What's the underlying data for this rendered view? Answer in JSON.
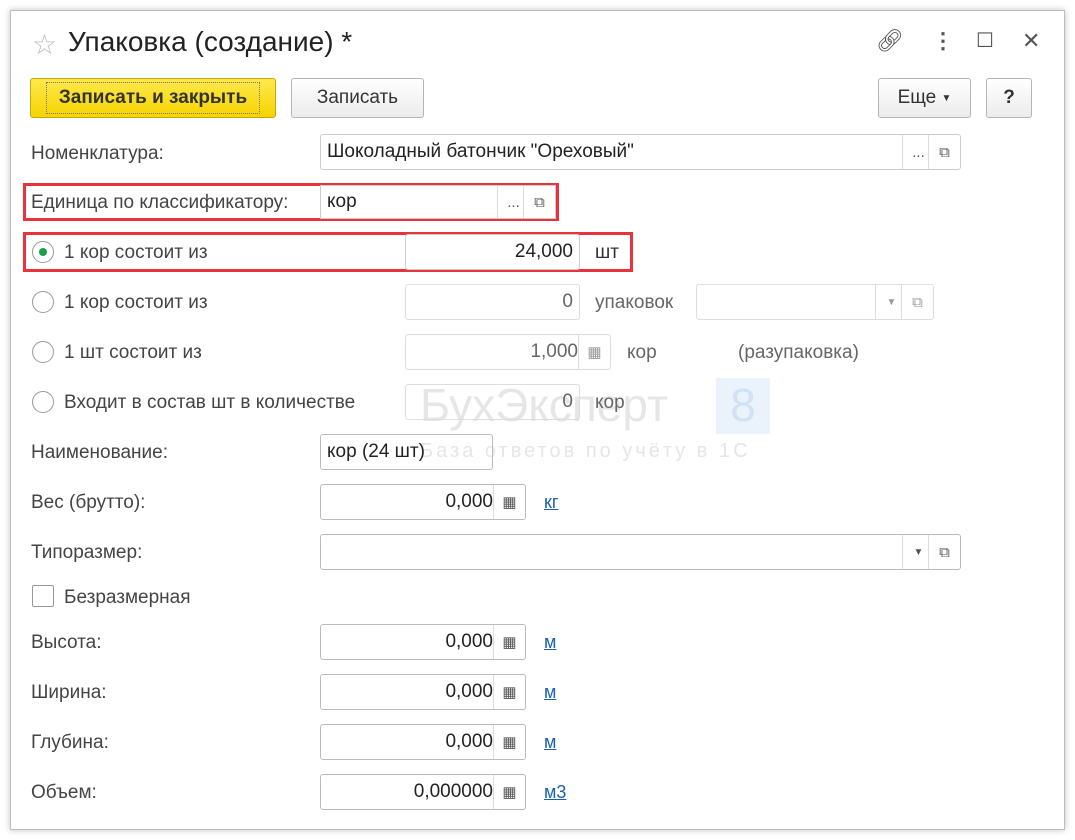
{
  "window": {
    "title": "Упаковка (создание) *"
  },
  "toolbar": {
    "save_close": "Записать и закрыть",
    "save": "Записать",
    "more": "Еще",
    "help": "?"
  },
  "form": {
    "nomenclature": {
      "label": "Номенклатура:",
      "value": "Шоколадный батончик \"Ореховый\""
    },
    "unit": {
      "label": "Единица по классификатору:",
      "value": "кор"
    },
    "opt1": {
      "label": "1 кор состоит из",
      "value": "24,000",
      "unit": "шт",
      "selected": true
    },
    "opt2": {
      "label": "1 кор состоит из",
      "value": "0",
      "unit": "упаковок"
    },
    "opt3": {
      "label": "1 шт состоит из",
      "value": "1,000",
      "unit": "кор",
      "note": "(разупаковка)"
    },
    "opt4": {
      "label": "Входит в состав шт в количестве",
      "value": "0",
      "unit": "кор"
    },
    "name": {
      "label": "Наименование:",
      "value": "кор (24 шт)"
    },
    "weight": {
      "label": "Вес (брутто):",
      "value": "0,000",
      "unit": "кг"
    },
    "size": {
      "label": "Типоразмер:",
      "value": ""
    },
    "dimless": {
      "label": "Безразмерная",
      "checked": false
    },
    "height": {
      "label": "Высота:",
      "value": "0,000",
      "unit": "м"
    },
    "width": {
      "label": "Ширина:",
      "value": "0,000",
      "unit": "м"
    },
    "depth": {
      "label": "Глубина:",
      "value": "0,000",
      "unit": "м"
    },
    "volume": {
      "label": "Объем:",
      "value": "0,000000",
      "unit": "м3"
    }
  },
  "watermark": {
    "brand": "БухЭксперт",
    "num": "8",
    "tagline": "База ответов по учёту в 1С"
  },
  "colors": {
    "highlight": "#e8323c",
    "primary": "#f5d300",
    "link": "#1a5fb4"
  }
}
